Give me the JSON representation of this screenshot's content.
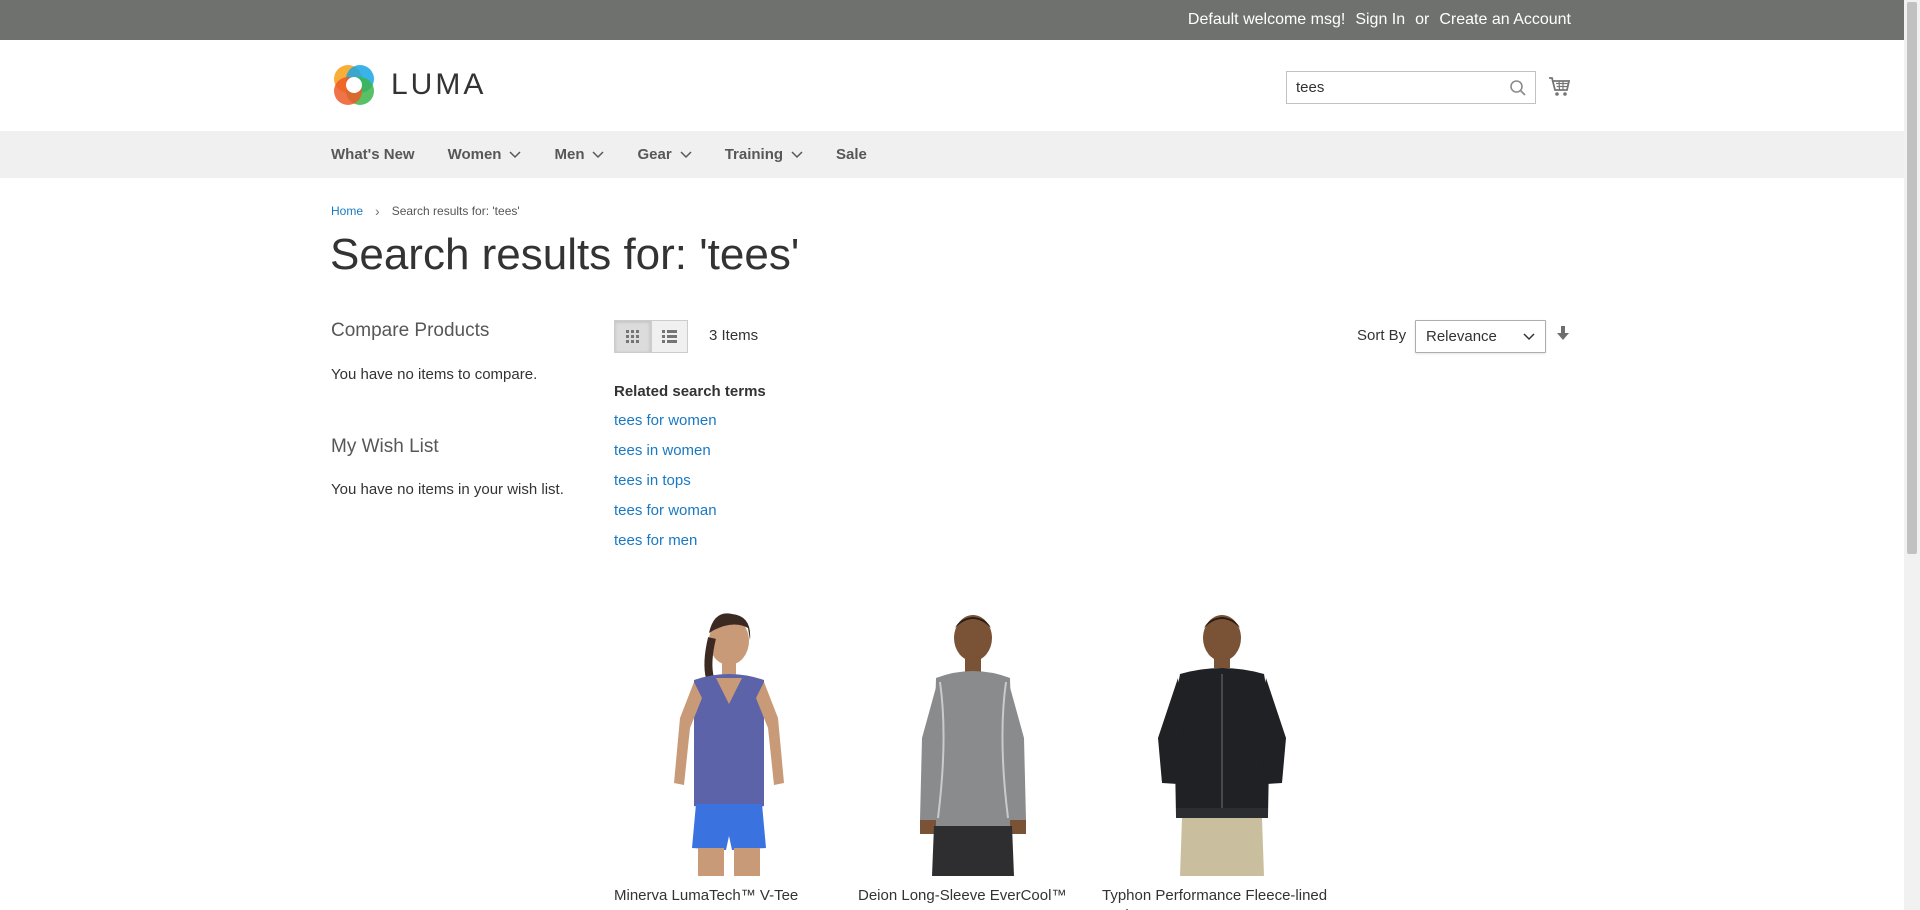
{
  "topbar": {
    "welcome": "Default welcome msg!",
    "sign_in": "Sign In",
    "or": "or",
    "create_account": "Create an Account"
  },
  "header": {
    "logo_text": "LUMA",
    "search_value": "tees"
  },
  "nav": {
    "items": [
      {
        "label": "What's New",
        "has_dropdown": false
      },
      {
        "label": "Women",
        "has_dropdown": true
      },
      {
        "label": "Men",
        "has_dropdown": true
      },
      {
        "label": "Gear",
        "has_dropdown": true
      },
      {
        "label": "Training",
        "has_dropdown": true
      },
      {
        "label": "Sale",
        "has_dropdown": false
      }
    ]
  },
  "breadcrumb": {
    "home": "Home",
    "separator": "›",
    "current": "Search results for: 'tees'"
  },
  "page_title": "Search results for: 'tees'",
  "sidebar": {
    "compare_title": "Compare Products",
    "compare_empty": "You have no items to compare.",
    "wishlist_title": "My Wish List",
    "wishlist_empty": "You have no items in your wish list."
  },
  "toolbar": {
    "view_modes": [
      "grid",
      "list"
    ],
    "active_mode": "grid",
    "items_count": "3 Items",
    "sort_label": "Sort By",
    "sort_value": "Relevance"
  },
  "related": {
    "title": "Related search terms",
    "terms": [
      "tees for women",
      "tees in women",
      "tees in tops",
      "tees for woman",
      "tees for men"
    ]
  },
  "products": [
    {
      "name": "Minerva LumaTech™ V-Tee"
    },
    {
      "name": "Deion Long-Sleeve EverCool™ Tee"
    },
    {
      "name": "Typhon Performance Fleece-lined Jacket"
    }
  ],
  "colors": {
    "topbar_bg": "#6e716e",
    "nav_bg": "#f0f0f0",
    "link": "#1979c3"
  }
}
